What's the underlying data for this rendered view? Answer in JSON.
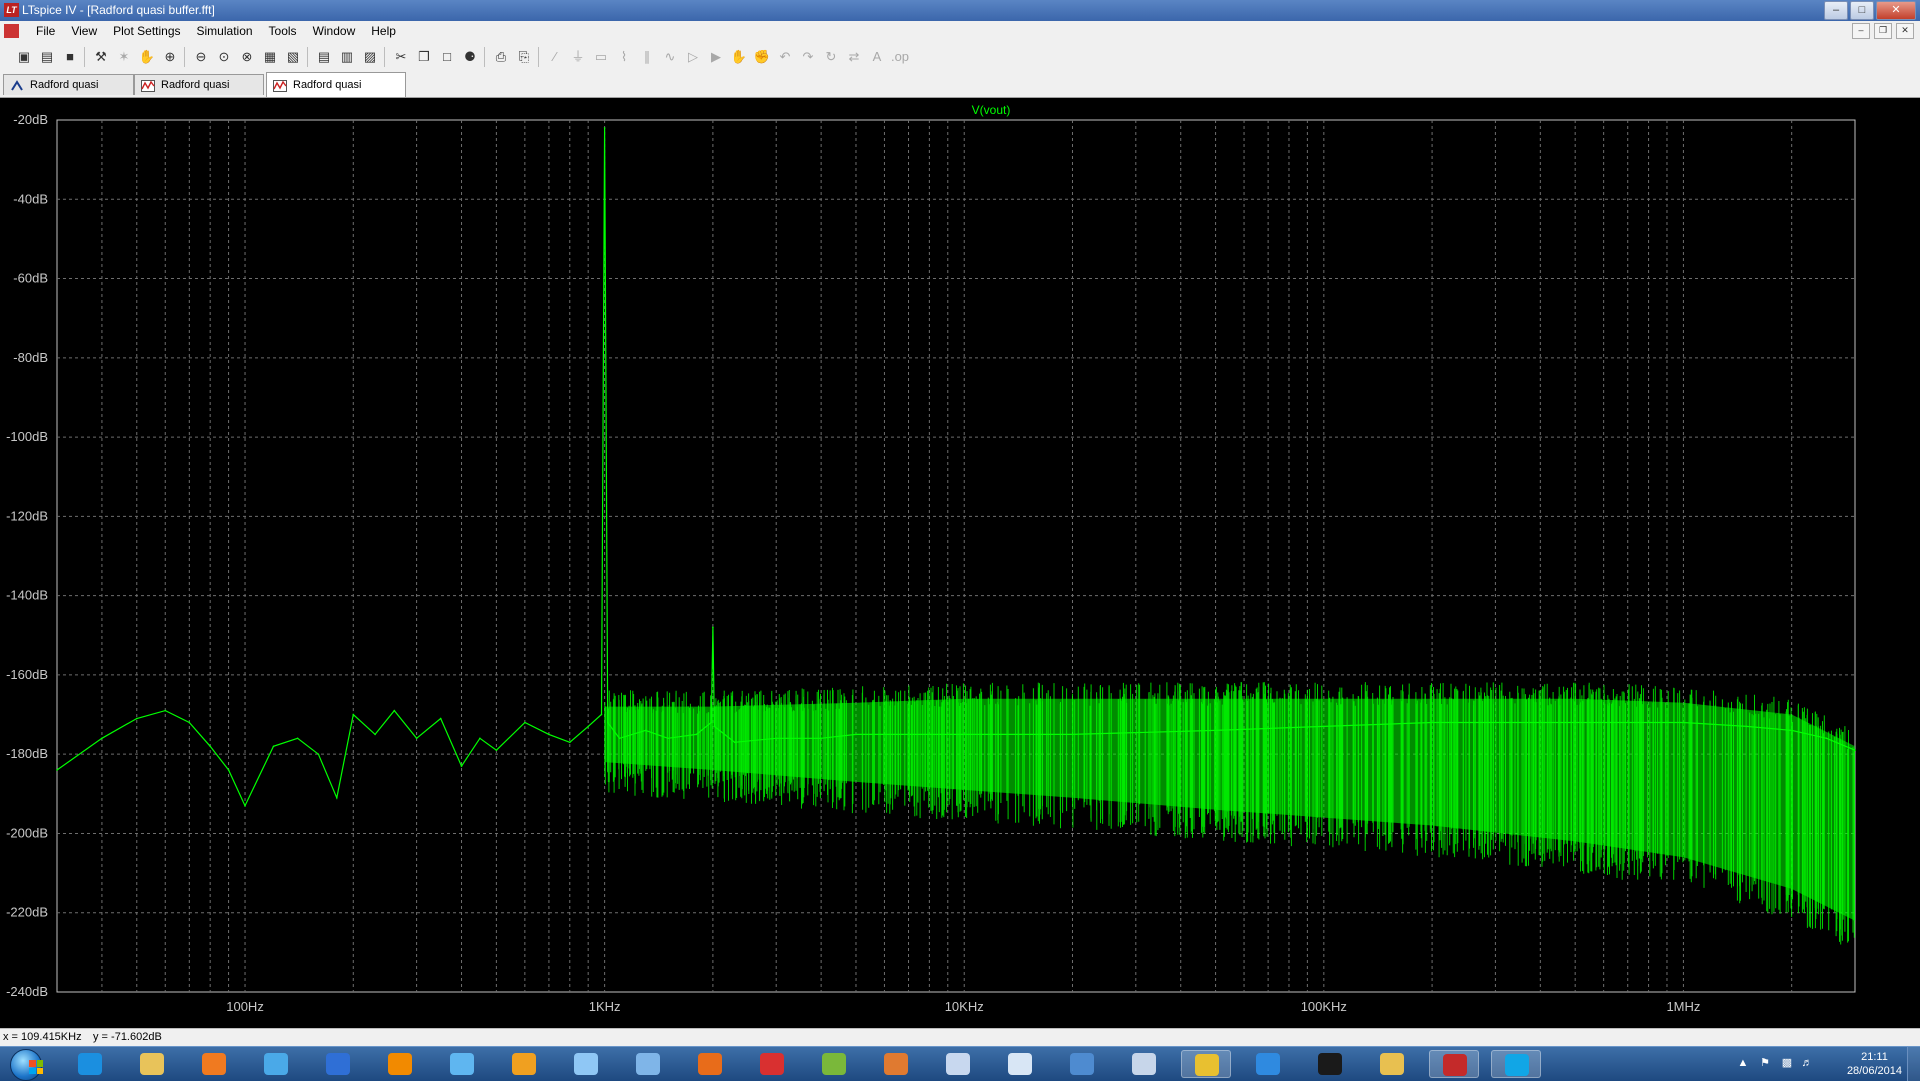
{
  "window": {
    "title": "LTspice IV - [Radford quasi buffer.fft]",
    "app_logo": "LT"
  },
  "menu": {
    "items": [
      "File",
      "View",
      "Plot Settings",
      "Simulation",
      "Tools",
      "Window",
      "Help"
    ]
  },
  "toolbar": {
    "icons": [
      "new-schematic-icon",
      "open-icon",
      "save-icon",
      "control-panel-icon",
      "run-icon",
      "halt-icon",
      "zoom-in-icon",
      "zoom-out-icon",
      "zoom-area-icon",
      "zoom-cancel-icon",
      "autorange-icon",
      "manual-limits-icon",
      "tile-horizontal-icon",
      "cascade-icon",
      "tile-vertical-icon",
      "cut-icon",
      "copy-icon",
      "paste-icon",
      "find-icon",
      "print-icon",
      "print-preview-icon",
      "wire-icon",
      "ground-icon",
      "label-icon",
      "resistor-icon",
      "capacitor-icon",
      "inductor-icon",
      "diode-icon",
      "component-icon",
      "move-icon",
      "drag-icon",
      "undo-icon",
      "redo-icon",
      "rotate-icon",
      "mirror-icon",
      "text-icon",
      "spice-directive-icon"
    ]
  },
  "tabs": [
    {
      "label": "Radford quasi buffer",
      "icon": "schematic-icon"
    },
    {
      "label": "Radford quasi buffer",
      "icon": "waveform-icon"
    },
    {
      "label": "Radford quasi buffer.fft",
      "icon": "waveform-icon",
      "active": true
    }
  ],
  "status": {
    "cursor_x": "x = 109.415KHz",
    "cursor_y": "y = -71.602dB"
  },
  "chart_data": {
    "type": "line",
    "title": "V(vout)",
    "xlabel": "",
    "ylabel": "",
    "xscale": "log",
    "xlim": [
      30,
      3000000
    ],
    "ylim": [
      -240,
      -20
    ],
    "grid": true,
    "xtick_labels": [
      "100Hz",
      "1KHz",
      "10KHz",
      "100KHz",
      "1MHz"
    ],
    "ytick_labels": [
      "-20dB",
      "-40dB",
      "-60dB",
      "-80dB",
      "-100dB",
      "-120dB",
      "-140dB",
      "-160dB",
      "-180dB",
      "-200dB",
      "-220dB",
      "-240dB"
    ],
    "series": [
      {
        "name": "V(vout)",
        "color": "#00ff00",
        "x": [
          30,
          40,
          50,
          60,
          70,
          80,
          90,
          100,
          120,
          140,
          160,
          180,
          200,
          230,
          260,
          300,
          350,
          400,
          450,
          500,
          600,
          700,
          800,
          900,
          980,
          1000,
          1020,
          1100,
          1300,
          1500,
          1800,
          1980,
          2000,
          2020,
          2300,
          3000,
          4000,
          5000,
          7000,
          10000,
          20000,
          50000,
          100000,
          200000,
          500000,
          1000000,
          1500000,
          2000000,
          2500000,
          3000000
        ],
        "y": [
          -184,
          -176,
          -171,
          -169,
          -172,
          -178,
          -184,
          -193,
          -178,
          -176,
          -180,
          -191,
          -170,
          -175,
          -169,
          -176,
          -171,
          -183,
          -176,
          -179,
          -172,
          -175,
          -177,
          -173,
          -170,
          -22,
          -172,
          -176,
          -174,
          -176,
          -175,
          -172,
          -148,
          -173,
          -177,
          -176,
          -176,
          -175,
          -175,
          -175,
          -175,
          -174,
          -173,
          -172,
          -172,
          -172,
          -173,
          -174,
          -176,
          -179
        ]
      }
    ],
    "noise_floor": {
      "x": [
        1000,
        2000,
        5000,
        10000,
        20000,
        50000,
        100000,
        200000,
        500000,
        1000000,
        2000000,
        3000000
      ],
      "upper": [
        -168,
        -168,
        -167,
        -166,
        -166,
        -166,
        -166,
        -166,
        -166,
        -167,
        -170,
        -178
      ],
      "lower": [
        -182,
        -184,
        -187,
        -189,
        -191,
        -194,
        -196,
        -198,
        -202,
        -206,
        -214,
        -222
      ]
    }
  },
  "taskbar": {
    "apps": [
      {
        "icon": "internet-explorer-icon",
        "color": "#1b8fe0"
      },
      {
        "icon": "folder-icon",
        "color": "#e8c35a"
      },
      {
        "icon": "media-player-icon",
        "color": "#f07a20"
      },
      {
        "icon": "network-icon",
        "color": "#4aa9e8"
      },
      {
        "icon": "app-blue-icon",
        "color": "#2f6fd6"
      },
      {
        "icon": "vlc-icon",
        "color": "#f28a00"
      },
      {
        "icon": "chat-icon",
        "color": "#5fb6f0"
      },
      {
        "icon": "headphones-icon",
        "color": "#f0a020"
      },
      {
        "icon": "itunes-icon",
        "color": "#8fc7f5"
      },
      {
        "icon": "notes-icon",
        "color": "#7fb5e8"
      },
      {
        "icon": "firefox-icon",
        "color": "#e86c1a"
      },
      {
        "icon": "app-red-icon",
        "color": "#d93030"
      },
      {
        "icon": "stack-icon",
        "color": "#7ab83a"
      },
      {
        "icon": "glove-icon",
        "color": "#e07a30"
      },
      {
        "icon": "spiral-icon",
        "color": "#c8d8ef"
      },
      {
        "icon": "tool-icon",
        "color": "#d8e6f5"
      },
      {
        "icon": "bird-icon",
        "color": "#4e8bd0"
      },
      {
        "icon": "calculator-icon",
        "color": "#c7d6ea"
      },
      {
        "icon": "chrome-icon",
        "color": "#e8c030",
        "active": true
      },
      {
        "icon": "browser-icon",
        "color": "#2f8ae0"
      },
      {
        "icon": "curve-icon",
        "color": "#1a1a1a"
      },
      {
        "icon": "pencil-icon",
        "color": "#e8c050"
      },
      {
        "icon": "ltspice-icon",
        "color": "#c42a2a",
        "active": true
      },
      {
        "icon": "skype-icon",
        "color": "#11a6e6",
        "active": true
      }
    ],
    "tray_icons": [
      "tray-up-icon",
      "flag-icon",
      "signal-icon",
      "volume-icon"
    ],
    "clock_time": "21:11",
    "clock_date": "28/06/2014"
  }
}
